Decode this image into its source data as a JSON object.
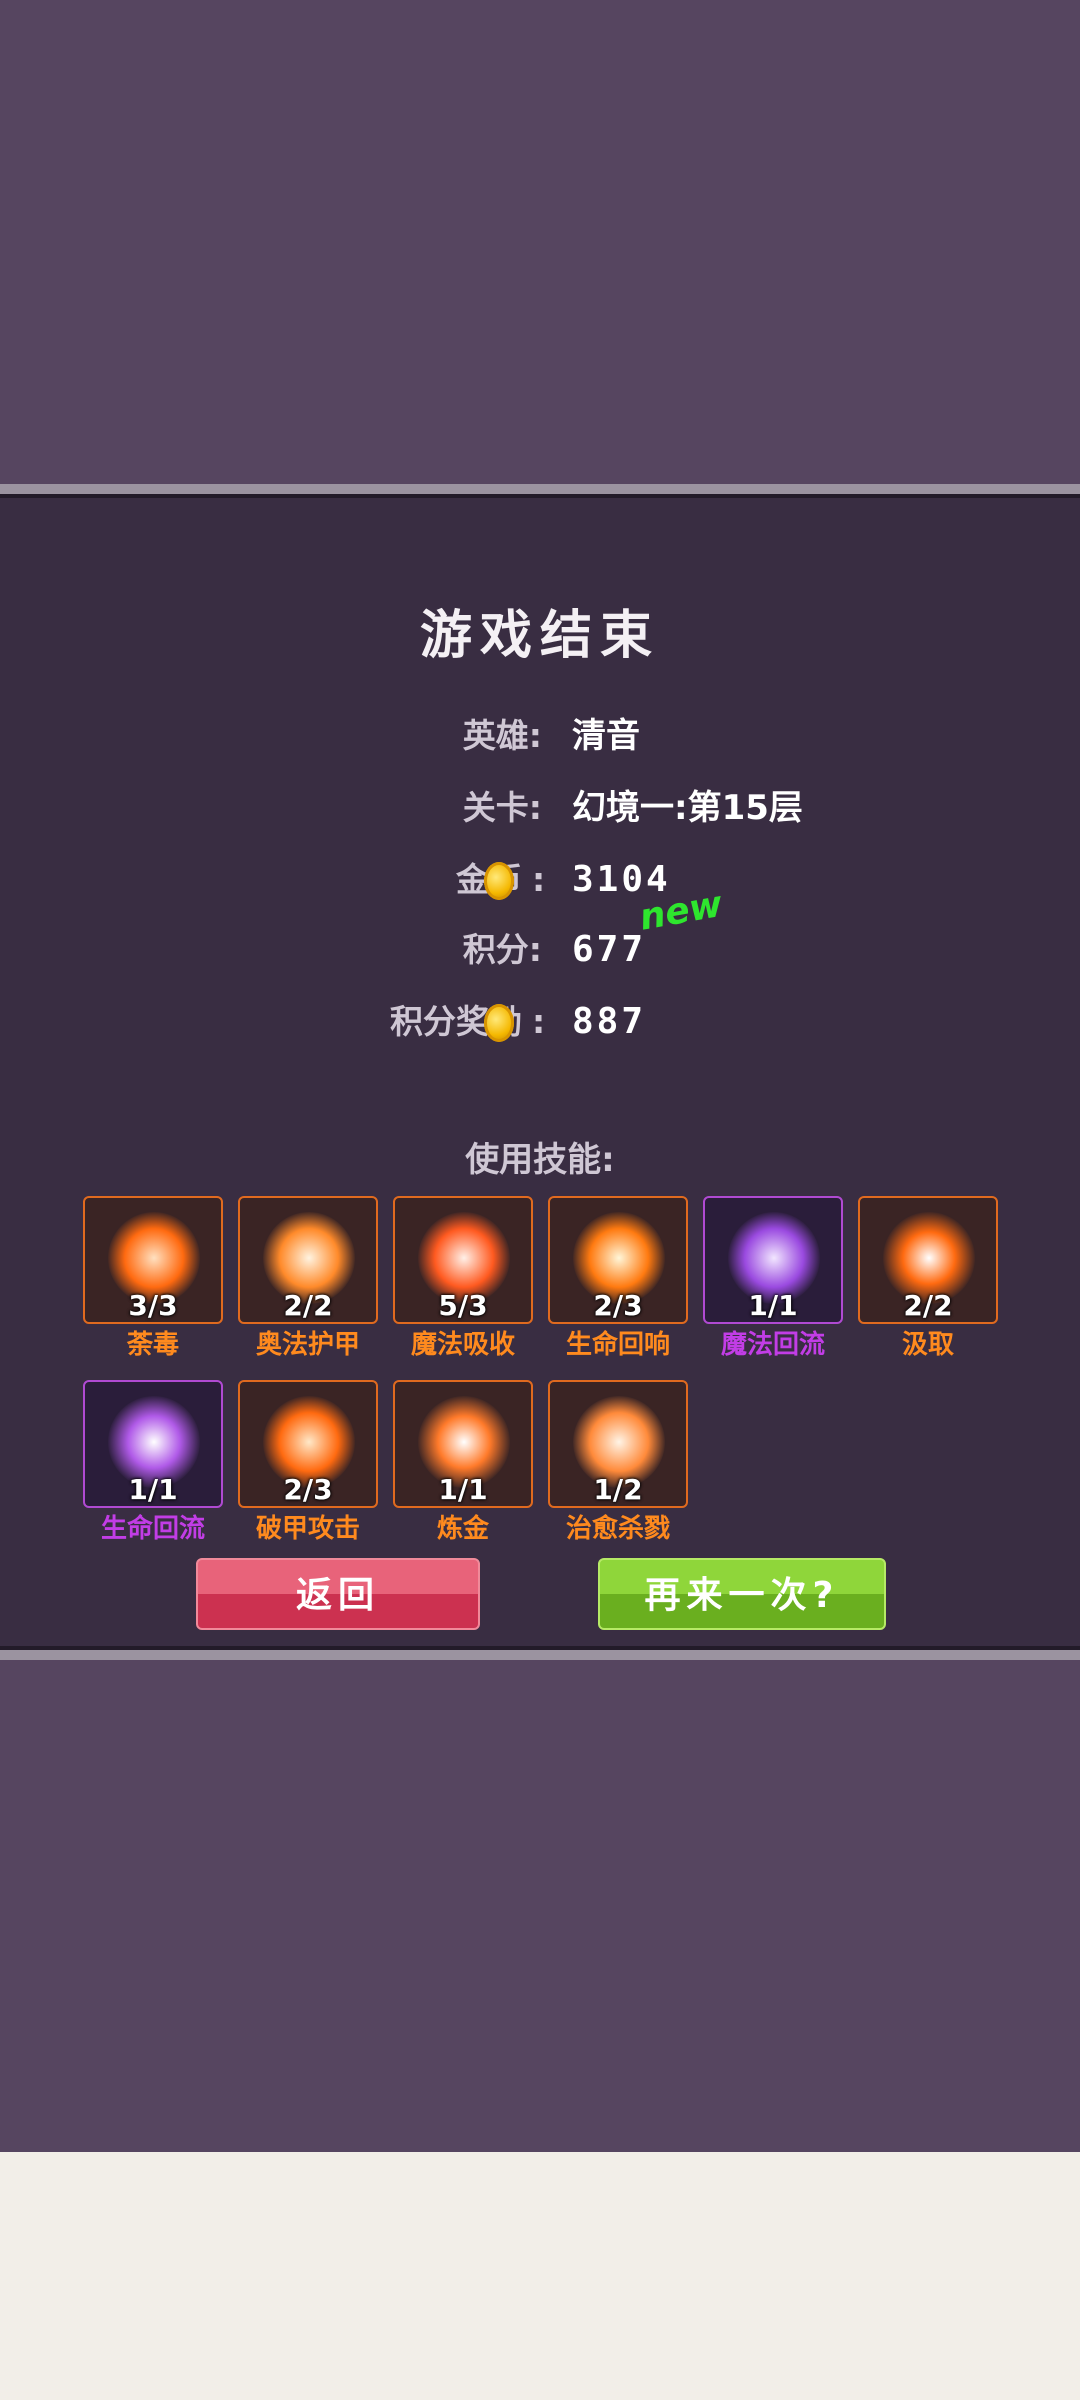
{
  "panel": {
    "title": "游戏结束",
    "hero": {
      "label": "英雄:",
      "value": "清音"
    },
    "stage": {
      "label": "关卡:",
      "value": "幻境一:第15层"
    },
    "gold": {
      "label": "金币",
      "colon": ":",
      "value": "3104"
    },
    "score": {
      "label": "积分:",
      "value": "677",
      "badge": "new"
    },
    "score_reward": {
      "label": "积分奖励",
      "colon": ":",
      "value": "887"
    },
    "skills_title": "使用技能:",
    "skills": [
      {
        "name": "荼毒",
        "count": "3/3",
        "rarity": "orange",
        "icon": "poison-blade-icon"
      },
      {
        "name": "奥法护甲",
        "count": "2/2",
        "rarity": "orange",
        "icon": "arcane-armor-icon"
      },
      {
        "name": "魔法吸收",
        "count": "5/3",
        "rarity": "orange",
        "icon": "magic-absorb-icon"
      },
      {
        "name": "生命回响",
        "count": "2/3",
        "rarity": "orange",
        "icon": "life-echo-icon"
      },
      {
        "name": "魔法回流",
        "count": "1/1",
        "rarity": "purple",
        "icon": "magic-reflow-icon"
      },
      {
        "name": "汲取",
        "count": "2/2",
        "rarity": "orange",
        "icon": "drain-icon"
      },
      {
        "name": "生命回流",
        "count": "1/1",
        "rarity": "purple",
        "icon": "life-reflow-icon"
      },
      {
        "name": "破甲攻击",
        "count": "2/3",
        "rarity": "orange",
        "icon": "armor-break-icon"
      },
      {
        "name": "炼金",
        "count": "1/1",
        "rarity": "orange",
        "icon": "alchemy-icon"
      },
      {
        "name": "治愈杀戮",
        "count": "1/2",
        "rarity": "orange",
        "icon": "healing-slaughter-icon"
      }
    ],
    "buttons": {
      "back": "返回",
      "retry": "再来一次?"
    }
  },
  "colors": {
    "orange": "#ff8a1e",
    "purple": "#c23de6",
    "back_button": "#d8405e",
    "retry_button": "#7cc52c"
  }
}
